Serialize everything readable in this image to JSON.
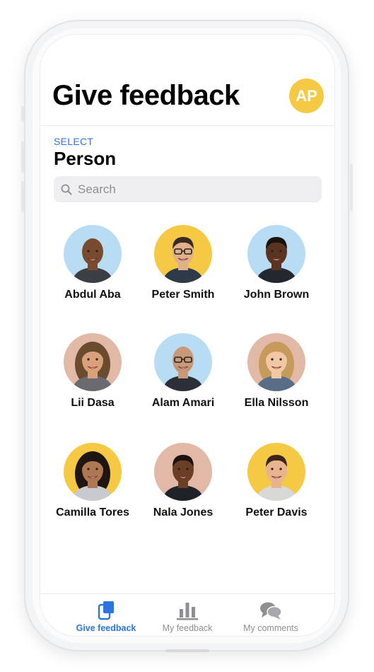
{
  "header": {
    "title": "Give feedback",
    "user_initials": "AP"
  },
  "section": {
    "eyebrow": "SELECT",
    "title": "Person"
  },
  "search": {
    "placeholder": "Search",
    "value": ""
  },
  "people": [
    {
      "name": "Abdul Aba",
      "bg": "#b9dcf5"
    },
    {
      "name": "Peter Smith",
      "bg": "#f6c944"
    },
    {
      "name": "John Brown",
      "bg": "#b9dcf5"
    },
    {
      "name": "Lii Dasa",
      "bg": "#e2b8a6"
    },
    {
      "name": "Alam Amari",
      "bg": "#b9dcf5"
    },
    {
      "name": "Ella Nilsson",
      "bg": "#e2b8a6"
    },
    {
      "name": "Camilla Tores",
      "bg": "#f6c944"
    },
    {
      "name": "Nala Jones",
      "bg": "#e2b8a6"
    },
    {
      "name": "Peter Davis",
      "bg": "#f6c944"
    }
  ],
  "tabs": [
    {
      "label": "Give feedback",
      "icon": "give-feedback-icon",
      "active": true
    },
    {
      "label": "My feedback",
      "icon": "bar-chart-icon",
      "active": false
    },
    {
      "label": "My comments",
      "icon": "chat-bubbles-icon",
      "active": false
    }
  ],
  "colors": {
    "accent": "#2a74e0",
    "avatar_yellow": "#f6c944",
    "avatar_blue": "#b9dcf5",
    "avatar_peach": "#e2b8a6",
    "inactive": "#8e8e93"
  }
}
